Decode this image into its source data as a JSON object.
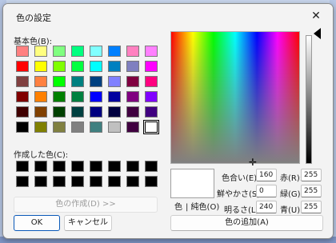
{
  "window": {
    "title": "色の設定",
    "close_glyph": "✕"
  },
  "basic_colors": {
    "label": "基本色(B):",
    "rows": [
      [
        "#ff8080",
        "#ffff80",
        "#80ff80",
        "#00ff80",
        "#80ffff",
        "#0080ff",
        "#ff80c0",
        "#ff80ff"
      ],
      [
        "#ff0000",
        "#ffff00",
        "#80ff00",
        "#00ff40",
        "#00ffff",
        "#0080c0",
        "#8080c0",
        "#ff00ff"
      ],
      [
        "#804040",
        "#ff8040",
        "#00ff00",
        "#008080",
        "#004080",
        "#8080ff",
        "#800040",
        "#ff0080"
      ],
      [
        "#800000",
        "#ff8000",
        "#008000",
        "#008040",
        "#0000ff",
        "#0000a0",
        "#800080",
        "#8000ff"
      ],
      [
        "#400000",
        "#804000",
        "#004000",
        "#004040",
        "#000080",
        "#000040",
        "#400040",
        "#400080"
      ],
      [
        "#000000",
        "#808000",
        "#808040",
        "#808080",
        "#408080",
        "#c0c0c0",
        "#400040",
        "#ffffff"
      ]
    ],
    "selected_index": 47
  },
  "custom_colors": {
    "label": "作成した色(C):",
    "rows": [
      [
        "#000000",
        "#000000",
        "#000000",
        "#000000",
        "#000000",
        "#000000",
        "#000000",
        "#000000"
      ],
      [
        "#000000",
        "#000000",
        "#000000",
        "#000000",
        "#000000",
        "#000000",
        "#000000",
        "#000000"
      ]
    ]
  },
  "buttons": {
    "define_custom": "色の作成(D) >>",
    "ok": "OK",
    "cancel": "キャンセル",
    "add_custom": "色の追加(A)"
  },
  "preview": {
    "color_label": "色",
    "solid_label": "| 純色(O)",
    "color": "#ffffff"
  },
  "hsl": {
    "hue_label": "色合い(E):",
    "hue": "160",
    "sat_label": "鮮やかさ(S):",
    "sat": "0",
    "lum_label": "明るさ(L):",
    "lum": "240"
  },
  "rgb": {
    "red_label": "赤(R):",
    "red": "255",
    "green_label": "緑(G):",
    "green": "255",
    "blue_label": "青(U):",
    "blue": "255"
  },
  "accent": "#0a59b8"
}
